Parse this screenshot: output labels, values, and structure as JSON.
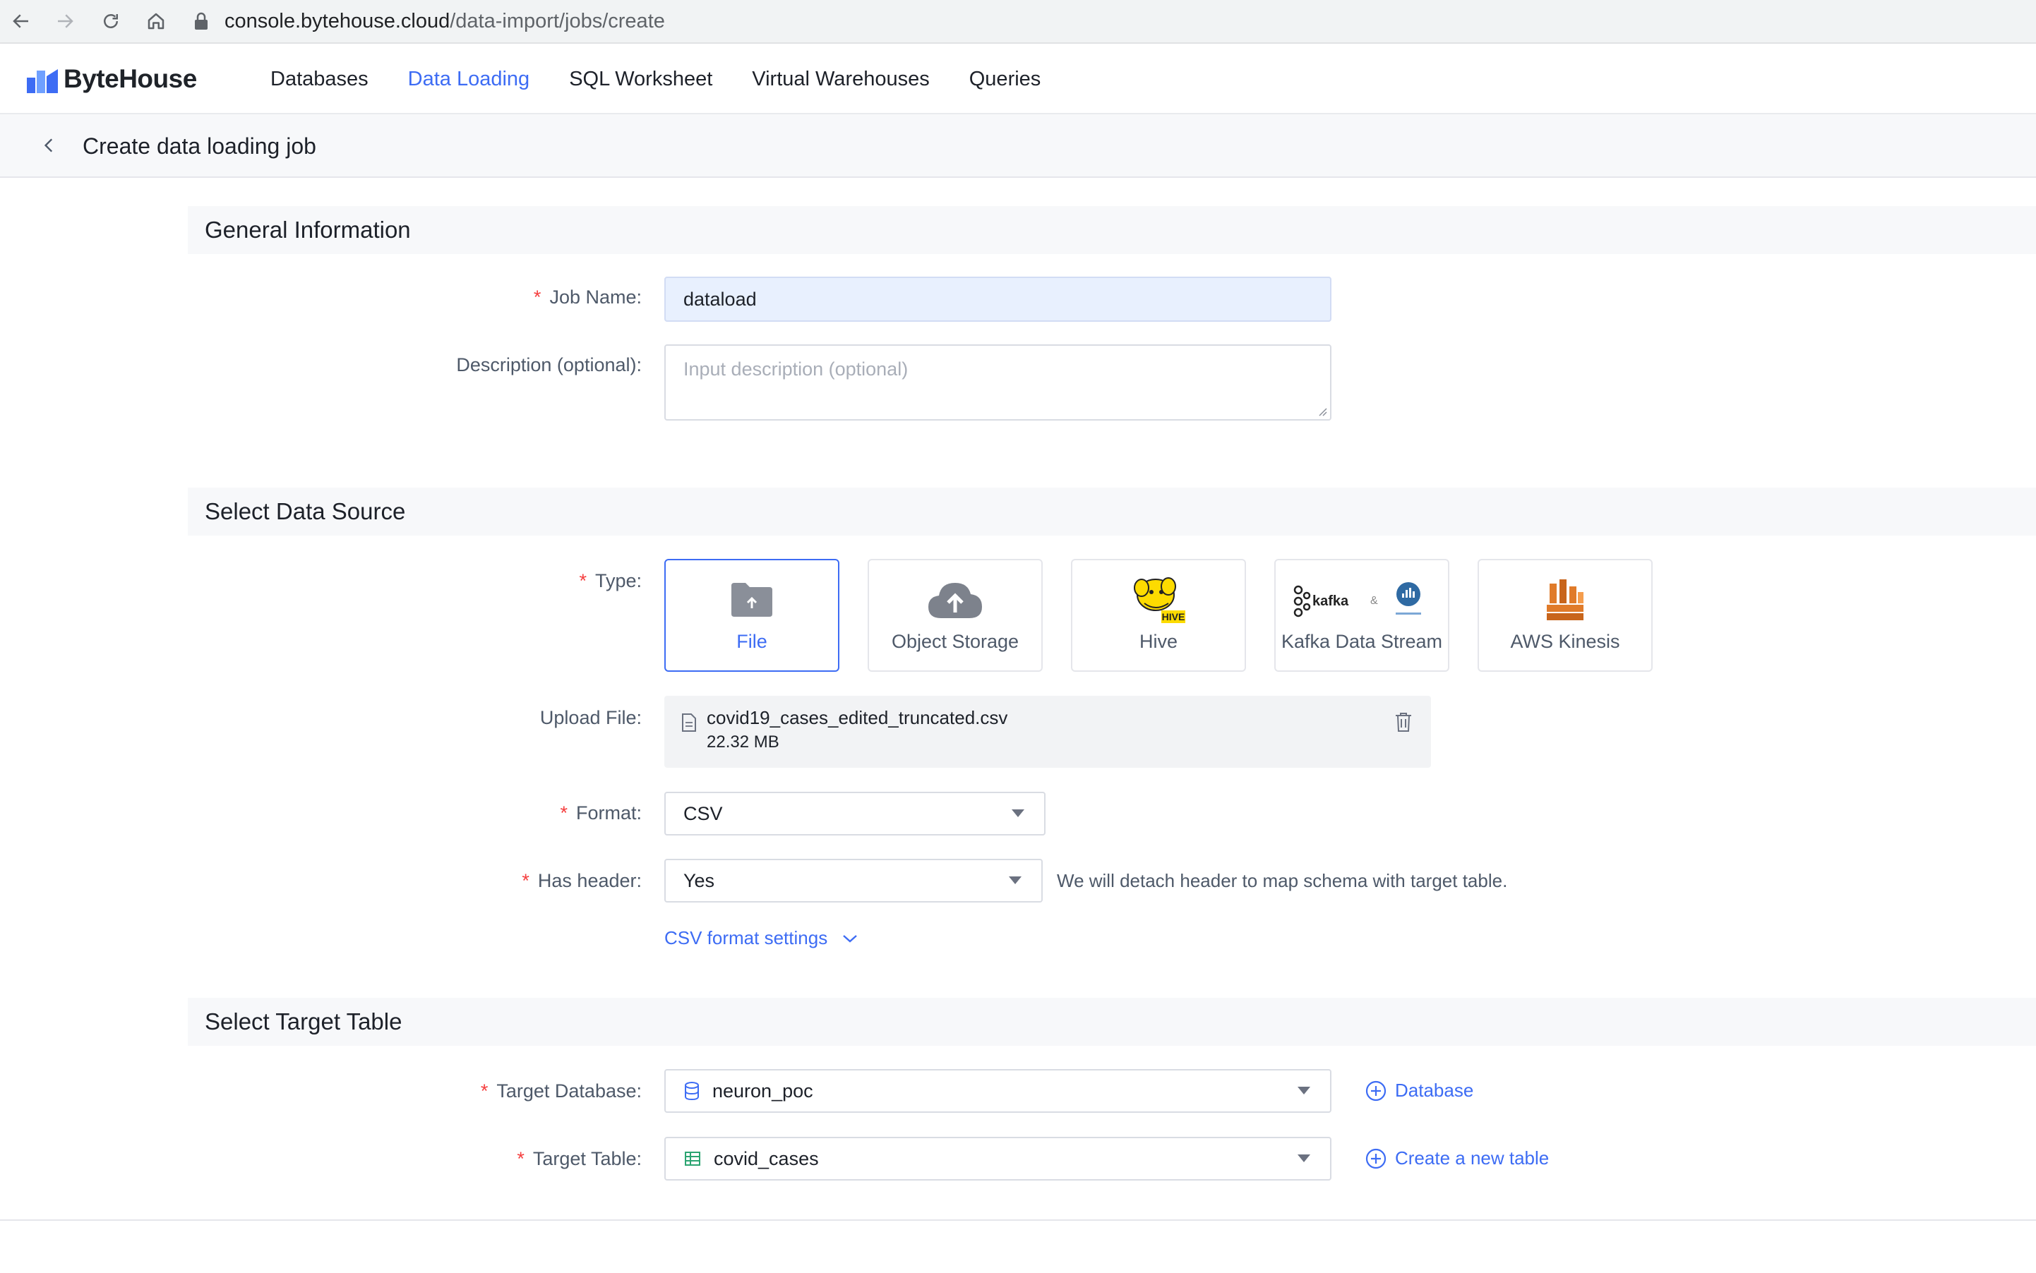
{
  "browser": {
    "url_host": "console.bytehouse.cloud",
    "url_path": "/data-import/jobs/create"
  },
  "app": {
    "logo_text": "ByteHouse",
    "brand_color": "#3d6cf4",
    "nav": [
      {
        "label": "Databases",
        "active": false
      },
      {
        "label": "Data Loading",
        "active": true
      },
      {
        "label": "SQL Worksheet",
        "active": false
      },
      {
        "label": "Virtual Warehouses",
        "active": false
      },
      {
        "label": "Queries",
        "active": false
      }
    ]
  },
  "page": {
    "title": "Create data loading job"
  },
  "general": {
    "section_title": "General Information",
    "job_name_label": "Job Name:",
    "job_name_value": "dataload",
    "description_label": "Description (optional):",
    "description_placeholder": "Input description (optional)"
  },
  "source": {
    "section_title": "Select Data Source",
    "type_label": "Type:",
    "types": [
      {
        "label": "File",
        "icon": "folder-upload-icon",
        "selected": true
      },
      {
        "label": "Object Storage",
        "icon": "cloud-upload-icon",
        "selected": false
      },
      {
        "label": "Hive",
        "icon": "hive-logo-icon",
        "selected": false
      },
      {
        "label": "Kafka Data Stream",
        "icon": "kafka-confluent-logo-icon",
        "selected": false
      },
      {
        "label": "AWS Kinesis",
        "icon": "aws-kinesis-icon",
        "selected": false
      }
    ],
    "kafka_logo_text": "kafka",
    "hive_logo_text": "HIVE",
    "upload_label": "Upload File:",
    "file_name": "covid19_cases_edited_truncated.csv",
    "file_size": "22.32 MB",
    "format_label": "Format:",
    "format_value": "CSV",
    "header_label": "Has header:",
    "header_value": "Yes",
    "header_hint": "We will detach header to map schema with target table.",
    "csv_settings_link": "CSV format settings"
  },
  "target": {
    "section_title": "Select Target Table",
    "database_label": "Target Database:",
    "database_value": "neuron_poc",
    "add_database": "Database",
    "table_label": "Target Table:",
    "table_value": "covid_cases",
    "create_table": "Create a new table"
  }
}
